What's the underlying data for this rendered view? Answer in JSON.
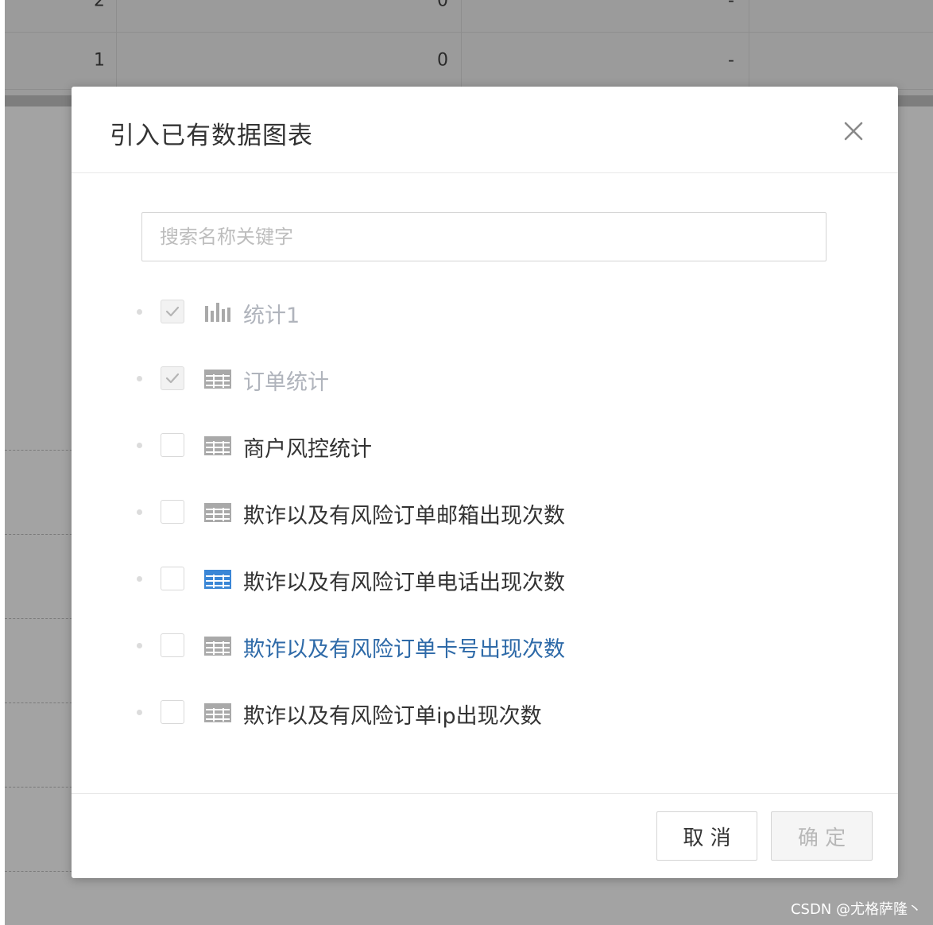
{
  "background_table": {
    "rows": [
      {
        "c1": "2",
        "c2": "0",
        "c3": "-"
      },
      {
        "c1": "1",
        "c2": "0",
        "c3": "-"
      }
    ]
  },
  "modal": {
    "title": "引入已有数据图表",
    "search_placeholder": "搜索名称关键字",
    "items": [
      {
        "label": "统计1",
        "checked": true,
        "disabled": true,
        "icon": "bar-chart-icon"
      },
      {
        "label": "订单统计",
        "checked": true,
        "disabled": true,
        "icon": "table-icon"
      },
      {
        "label": "商户风控统计",
        "checked": false,
        "disabled": false,
        "icon": "table-icon"
      },
      {
        "label": "欺诈以及有风险订单邮箱出现次数",
        "checked": false,
        "disabled": false,
        "icon": "table-icon"
      },
      {
        "label": "欺诈以及有风险订单电话出现次数",
        "checked": false,
        "disabled": false,
        "icon": "table-icon",
        "icon_highlight": true
      },
      {
        "label": "欺诈以及有风险订单卡号出现次数",
        "checked": false,
        "disabled": false,
        "icon": "table-icon",
        "label_highlight": true
      },
      {
        "label": "欺诈以及有风险订单ip出现次数",
        "checked": false,
        "disabled": false,
        "icon": "table-icon"
      }
    ],
    "cancel_label": "取 消",
    "ok_label": "确 定"
  },
  "watermark": "CSDN @尤格萨隆丶",
  "colors": {
    "accent_blue": "#2e6aa8",
    "icon_blue": "#3a86d6",
    "icon_gray": "#a9a9a9",
    "disabled_text": "#b0b4bc"
  }
}
